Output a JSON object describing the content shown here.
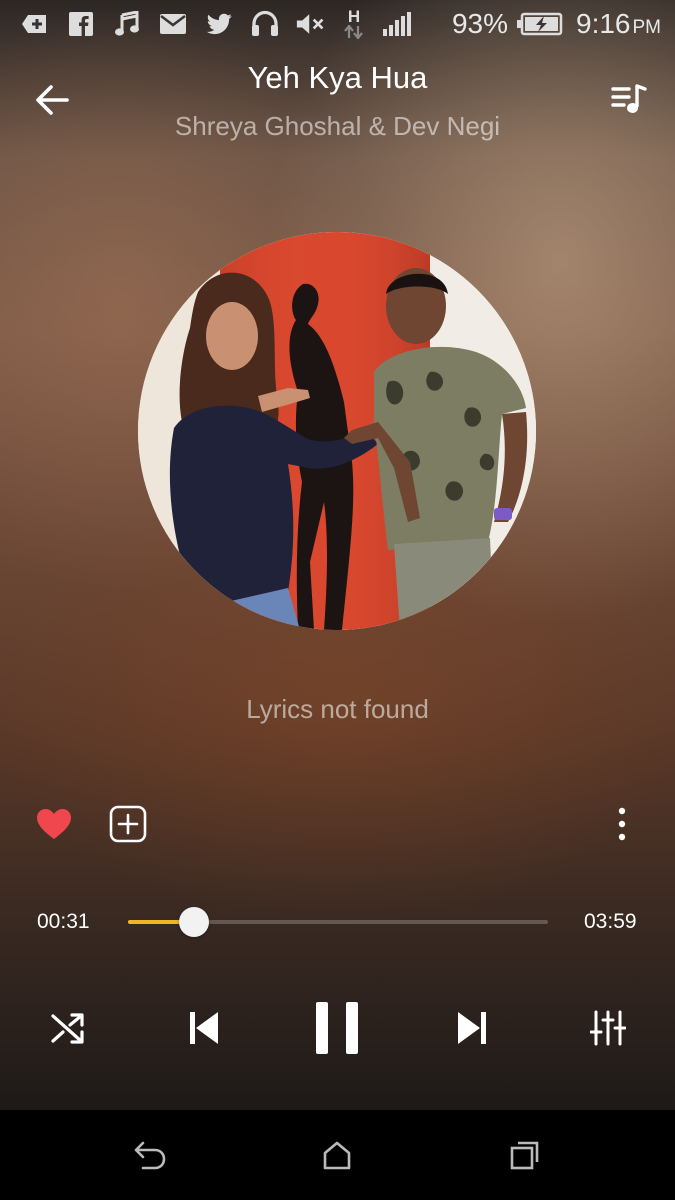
{
  "status_bar": {
    "icons": [
      "plus-circle-icon",
      "facebook-icon",
      "music-note-icon",
      "mail-icon",
      "twitter-icon",
      "headset-icon",
      "volume-mute-icon",
      "h-data-icon",
      "signal-icon",
      "battery-charging-icon"
    ],
    "network_type": "H",
    "battery": "93%",
    "time": "9:16",
    "meridiem": "PM"
  },
  "header": {
    "title": "Yeh Kya Hua",
    "artist": "Shreya Ghoshal & Dev Negi",
    "back_icon": "arrow-left-icon",
    "queue_icon": "playlist-icon"
  },
  "album": {
    "alt": "album-art"
  },
  "lyrics": {
    "message": "Lyrics not found"
  },
  "actions": {
    "favorite_icon": "heart-icon",
    "favorite_color": "#f0474f",
    "add_icon": "add-to-playlist-icon",
    "more_icon": "more-vertical-icon"
  },
  "progress": {
    "current": "00:31",
    "total": "03:59",
    "fraction": 0.156,
    "accent_color": "#f3b522"
  },
  "controls": {
    "shuffle_icon": "shuffle-icon",
    "prev_icon": "skip-previous-icon",
    "play_pause_icon": "pause-icon",
    "next_icon": "skip-next-icon",
    "equalizer_icon": "equalizer-icon"
  },
  "navbar": {
    "back_icon": "nav-back-icon",
    "home_icon": "nav-home-icon",
    "recents_icon": "nav-recents-icon"
  }
}
